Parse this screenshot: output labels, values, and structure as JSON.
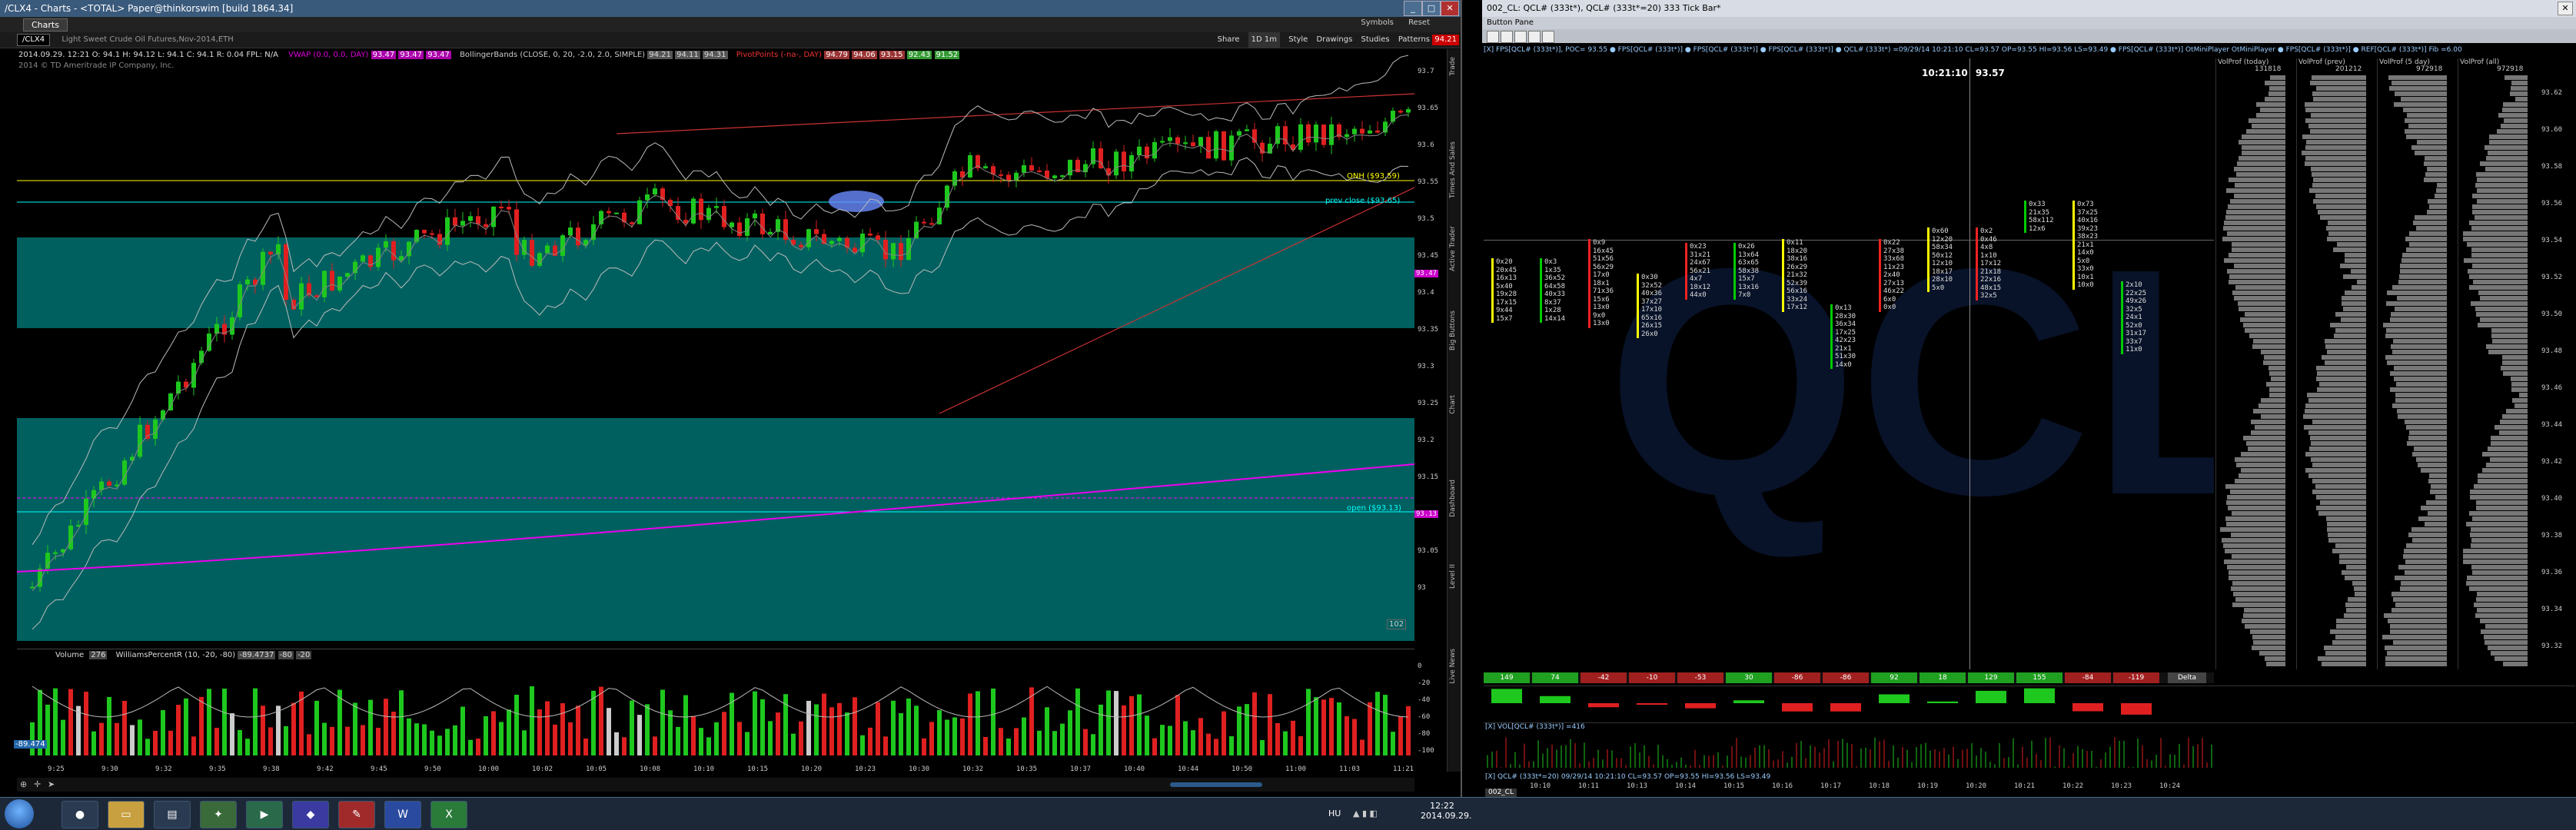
{
  "left_window": {
    "title": "/CLX4 - Charts - <TOTAL> Paper@thinkorswim [build 1864.34]",
    "tab_label": "Charts",
    "symbol": "/CLX4",
    "description": "Light Sweet Crude Oil Futures,Nov-2014,ETH",
    "header_buttons": [
      "Share",
      "Style",
      "Drawings",
      "Studies",
      "Patterns",
      "Symbols",
      "Reset"
    ],
    "timeframe": "1D 1m",
    "price_chip": "94.21",
    "quote_line": "2014.09.29. 12:21   O: 94.1   H: 94.12   L: 94.1   C: 94.1   R: 0.04   FPL: N/A",
    "study_vwap": "VWAP (0.0, 0.0, DAY)",
    "vwap_values": [
      "93.47",
      "93.47",
      "93.47"
    ],
    "study_bb": "BollingerBands (CLOSE, 0, 20, -2.0, 2.0, SIMPLE)",
    "bb_values": [
      "94.21",
      "94.11",
      "94.31"
    ],
    "study_pivots": "PivotPoints (-na-, DAY)",
    "pivot_values": [
      "94.79",
      "94.06",
      "93.15",
      "92.43",
      "91.52"
    ],
    "copyright": "2014 © TD Ameritrade IP Company, Inc.",
    "ann_onh": "ONH ($93.59)",
    "ann_prev_close": "prev close ($93.65)",
    "ann_open": "open ($93.13)",
    "price_ticks": [
      "93.7",
      "93.65",
      "93.6",
      "93.55",
      "93.5",
      "93.45",
      "93.4",
      "93.35",
      "93.3",
      "93.25",
      "93.2",
      "93.15",
      "93.1",
      "93.05",
      "93"
    ],
    "price_marker_top": "93.47",
    "price_marker_bottom": "93.13",
    "bars_label": "102",
    "lower_study_volume": "Volume",
    "volume_value": "276",
    "lower_study_wr": "WilliamsPercentR (10, -20, -80)",
    "wr_values": [
      "-89.4737",
      "-80",
      "-20"
    ],
    "wr_ticks": [
      "0",
      "-20",
      "-40",
      "-60",
      "-80",
      "-100"
    ],
    "wr_marker": "-89.474",
    "time_ticks": [
      "9:25",
      "9:30",
      "9:32",
      "9:35",
      "9:38",
      "9:42",
      "9:45",
      "9:50",
      "10:00",
      "10:02",
      "10:05",
      "10:08",
      "10:10",
      "10:15",
      "10:20",
      "10:23",
      "10:30",
      "10:32",
      "10:35",
      "10:37",
      "10:40",
      "10:44",
      "10:50",
      "11:00",
      "11:03",
      "11:21"
    ],
    "side_tabs": [
      "Trade",
      "Times And Sales",
      "Active Trader",
      "Big Buttons",
      "Chart",
      "Dashboard",
      "Level II",
      "Live News"
    ]
  },
  "right_window": {
    "title": "002_CL: QCL# (333t*), QCL# (333t*=20) 333 Tick Bar*",
    "menu": "Button Pane",
    "info_line": "[X] FPS[QCL# (333t*)], POC= 93.55 ● FPS[QCL# (333t*)] ● FPS[QCL# (333t*)] ● FPS[QCL# (333t*)] ● QCL# (333t*) =09/29/14 10:21:10 CL=93.57 OP=93.55 HI=93.56 LS=93.49 ● FPS[QCL# (333t*)] OtMiniPlayer OtMiniPlayer ● FPS[QCL# (333t*)] ● REF[QCL# (333t*)] Fib =6.00",
    "crosshair_time": "10:21:10",
    "crosshair_price": "93.57",
    "vp_headers": [
      "VolProf (today)",
      "VolProf (prev)",
      "VolProf (5 day)",
      "VolProf (all)"
    ],
    "vp_values": [
      "131818",
      "201212",
      "972918",
      "972918"
    ],
    "price_axis": [
      "93.62",
      "93.60",
      "93.58",
      "93.56",
      "93.54",
      "93.52",
      "93.50",
      "93.48",
      "93.46",
      "93.44",
      "93.42",
      "93.40",
      "93.38",
      "93.36",
      "93.34",
      "93.32"
    ],
    "delta_values": [
      "149",
      "74",
      "-42",
      "-10",
      "-53",
      "30",
      "-86",
      "-86",
      "92",
      "18",
      "129",
      "155",
      "-84",
      "-119"
    ],
    "delta_label": "Delta",
    "vol_line": "[X] VOL[QCL# (333t*)] =416",
    "bottom_info": "[X] QCL# (333t*=20) 09/29/14 10:21:10 CL=93.57 OP=93.55 HI=93.56 LS=93.49",
    "tab_label": "002_CL",
    "time_axis": [
      "10:10",
      "10:11",
      "10:13",
      "10:14",
      "10:15",
      "10:16",
      "10:17",
      "10:18",
      "10:19",
      "10:20",
      "10:21",
      "10:22",
      "10:23",
      "10:24"
    ],
    "watermark": "QCL"
  },
  "taskbar": {
    "language": "HU",
    "time": "12:22",
    "date": "2014.09.29."
  },
  "footprint": [
    "0x20\n20x45\n16x13\n5x40\n19x28\n17x15\n9x44\n15x7",
    "0x3\n1x35\n36x52\n64x58\n40x33\n8x37\n1x28\n14x14",
    "0x9\n16x45\n51x56\n56x29\n17x0\n18x1\n71x36\n15x6\n13x0\n9x0\n13x0",
    "0x30\n32x52\n40x36\n37x27\n17x10\n65x16\n26x15\n26x0",
    "0x23\n31x21\n24x67\n56x21\n4x7\n18x12\n44x0",
    "0x26\n13x64\n63x65\n58x38\n15x7\n13x16\n7x0",
    "0x11\n18x20\n38x16\n26x29\n21x32\n52x39\n56x16\n33x24\n17x12",
    "0x13\n28x30\n36x34\n17x25\n42x23\n21x1\n51x30\n14x0",
    "0x22\n27x38\n33x68\n11x23\n2x40\n27x13\n46x22\n6x0\n0x0",
    "0x60\n12x20\n58x34\n50x12\n12x10\n18x17\n28x10\n5x0",
    "0x2\n0x46\n4x8\n1x10\n17x12\n21x18\n22x16\n48x15\n32x5",
    "0x33\n21x35\n58x112\n12x6",
    "0x73\n37x25\n40x16\n39x23\n38x23\n21x1\n14x0\n5x0\n33x0\n10x1\n10x0",
    "2x10\n22x25\n49x26\n32x5\n24x1\n52x0\n31x17\n33x7\n11x0"
  ]
}
